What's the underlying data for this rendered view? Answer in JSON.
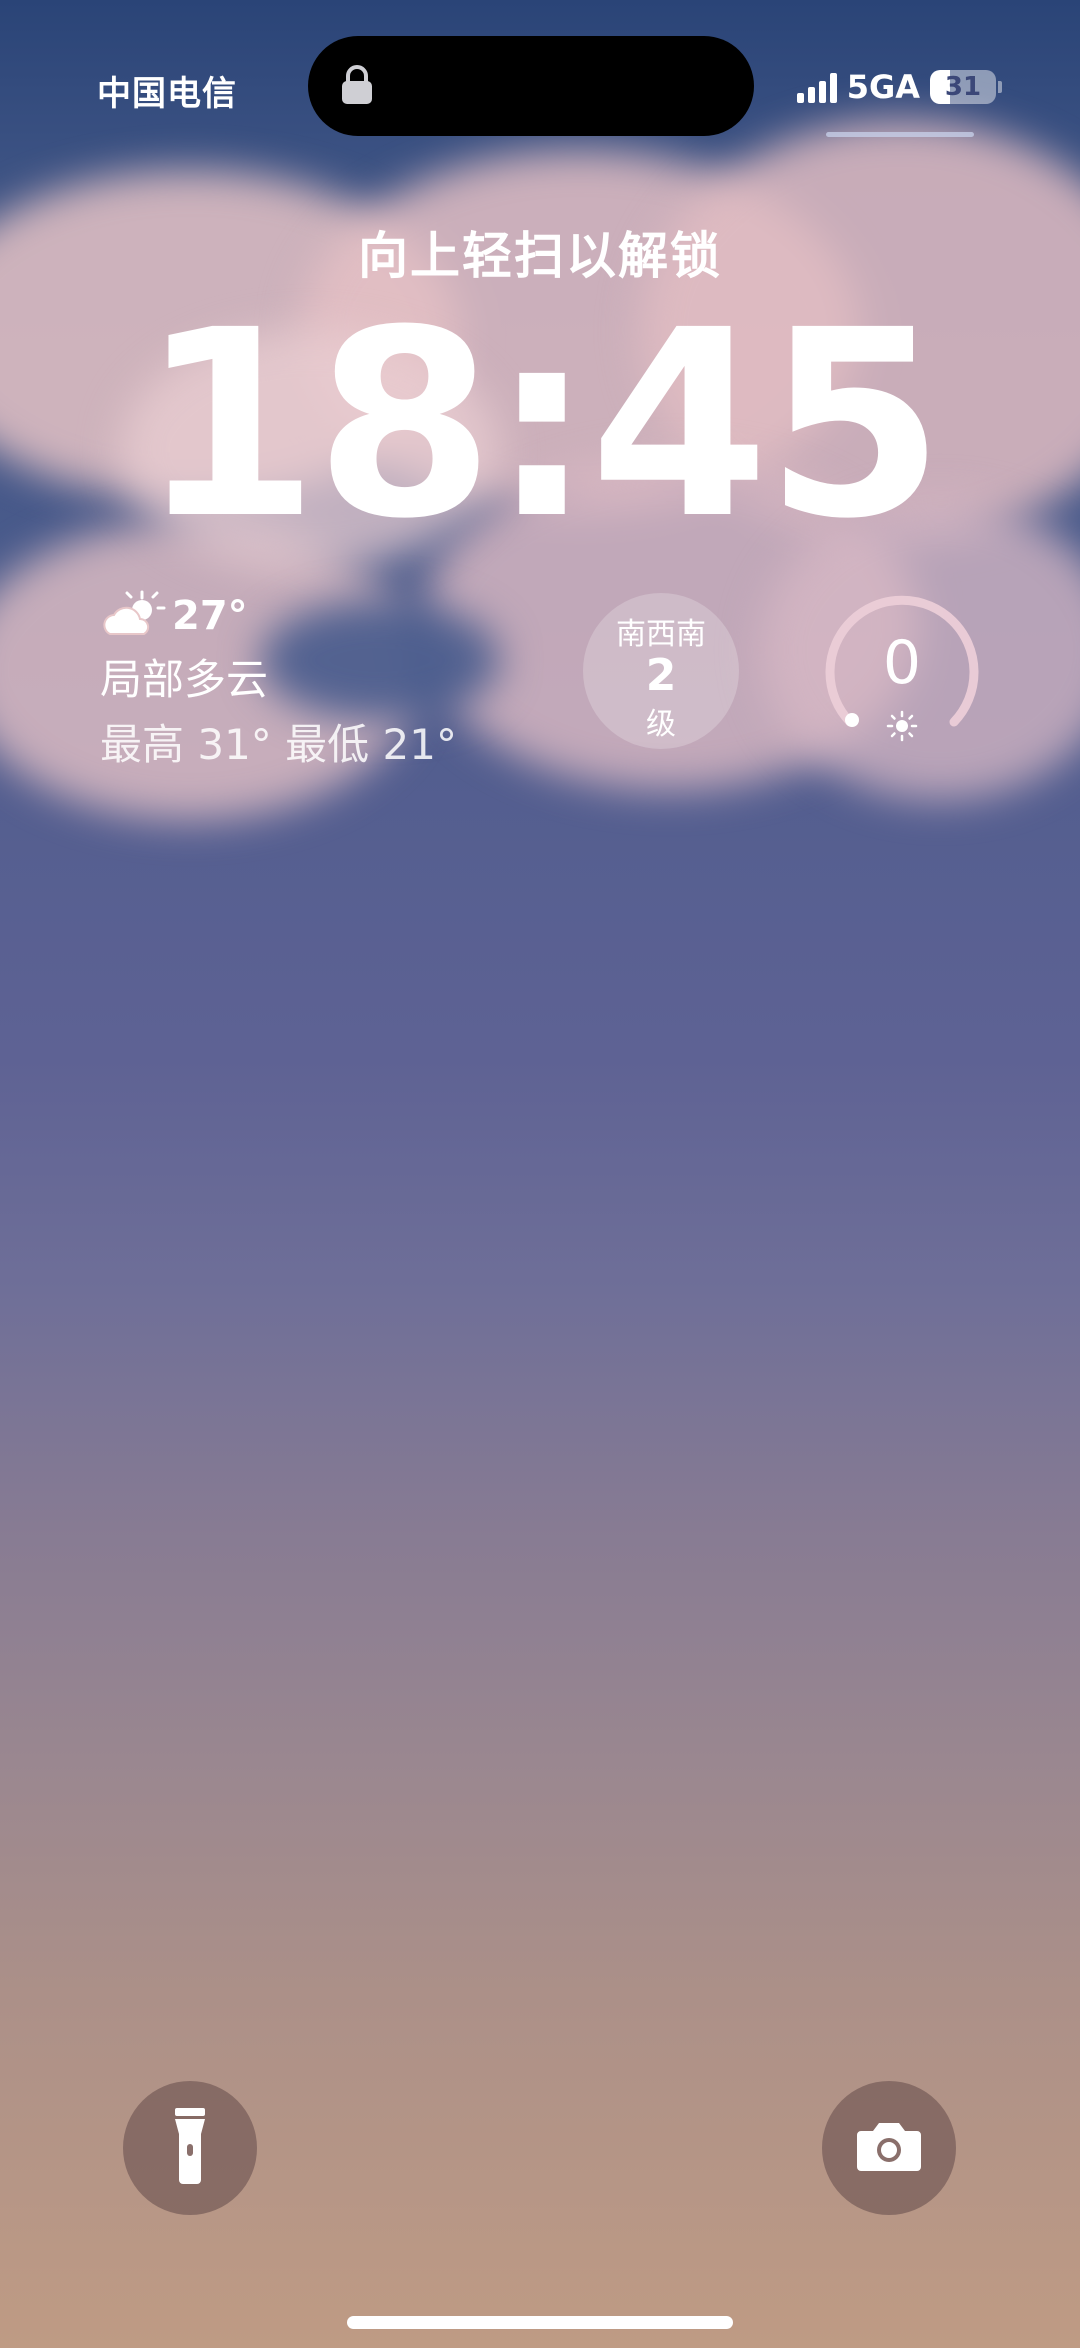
{
  "status_bar": {
    "carrier": "中国电信",
    "network": "5GA",
    "battery_percent": "31",
    "battery_level": 0.31
  },
  "lock_screen": {
    "unlock_hint": "向上轻扫以解锁",
    "time": "18:45"
  },
  "weather": {
    "icon": "partly-cloudy-icon",
    "temperature": "27°",
    "condition": "局部多云",
    "range": "最高 31° 最低 21°"
  },
  "wind": {
    "direction": "南西南",
    "level": "2",
    "unit": "级"
  },
  "uv": {
    "value": "0",
    "icon": "sun-icon"
  },
  "quick_actions": {
    "left_icon": "flashlight-icon",
    "right_icon": "camera-icon"
  },
  "colors": {
    "sky_top": "#2a4477",
    "sky_bottom": "#bf9b84",
    "cloud": "#e3c0c3"
  }
}
